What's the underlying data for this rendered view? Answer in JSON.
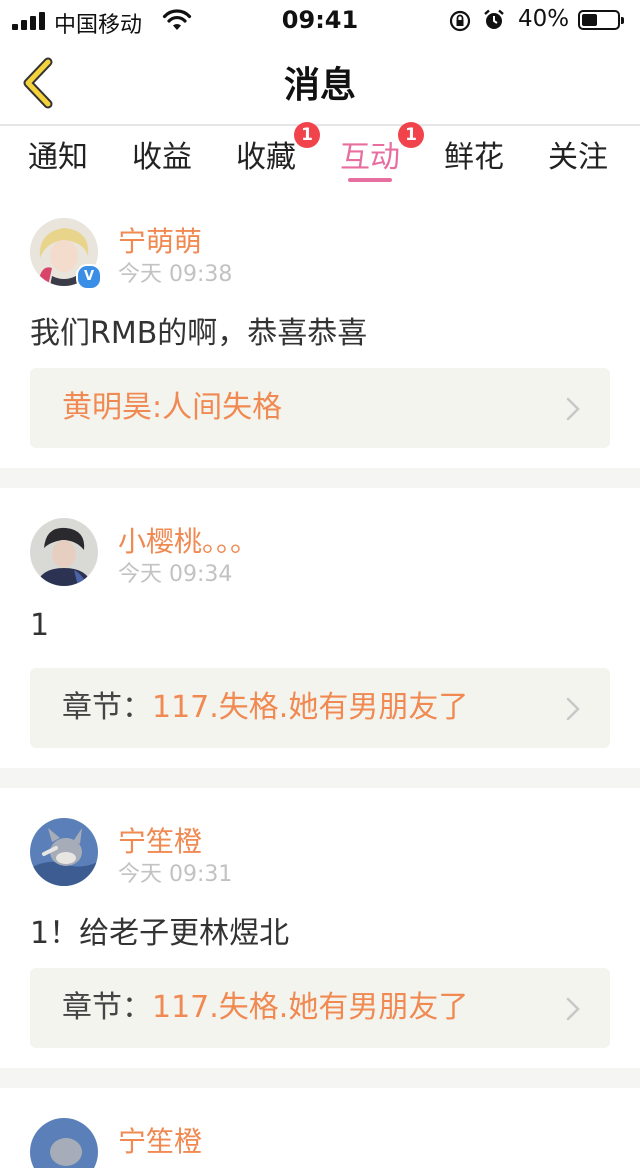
{
  "status_bar": {
    "carrier": "中国移动",
    "time": "09:41",
    "battery": "40%",
    "battery_level": 0.4
  },
  "nav": {
    "title": "消息"
  },
  "tabs": [
    {
      "label": "通知",
      "badge": null,
      "active": false
    },
    {
      "label": "收益",
      "badge": null,
      "active": false
    },
    {
      "label": "收藏",
      "badge": "1",
      "active": false
    },
    {
      "label": "互动",
      "badge": "1",
      "active": true
    },
    {
      "label": "鲜花",
      "badge": null,
      "active": false
    },
    {
      "label": "关注",
      "badge": null,
      "active": false
    }
  ],
  "messages": [
    {
      "username": "宁萌萌",
      "time": "今天 09:38",
      "verified": true,
      "content": "我们RMB的啊，恭喜恭喜",
      "ref_prefix": "",
      "ref_title": "黄明昊:人间失格"
    },
    {
      "username": "小樱桃。。。",
      "time": "今天 09:34",
      "verified": false,
      "content": "1",
      "ref_prefix": "章节：",
      "ref_title": "117.失格.她有男朋友了"
    },
    {
      "username": "宁笙橙",
      "time": "今天 09:31",
      "verified": false,
      "content": "1！给老子更林煜北",
      "ref_prefix": "章节：",
      "ref_title": "117.失格.她有男朋友了"
    },
    {
      "username": "宁笙橙"
    }
  ],
  "colors": {
    "accent_pink": "#e76fa0",
    "username_orange": "#f08a52",
    "badge_red": "#f0434b",
    "back_arrow_yellow": "#f3d23c"
  }
}
